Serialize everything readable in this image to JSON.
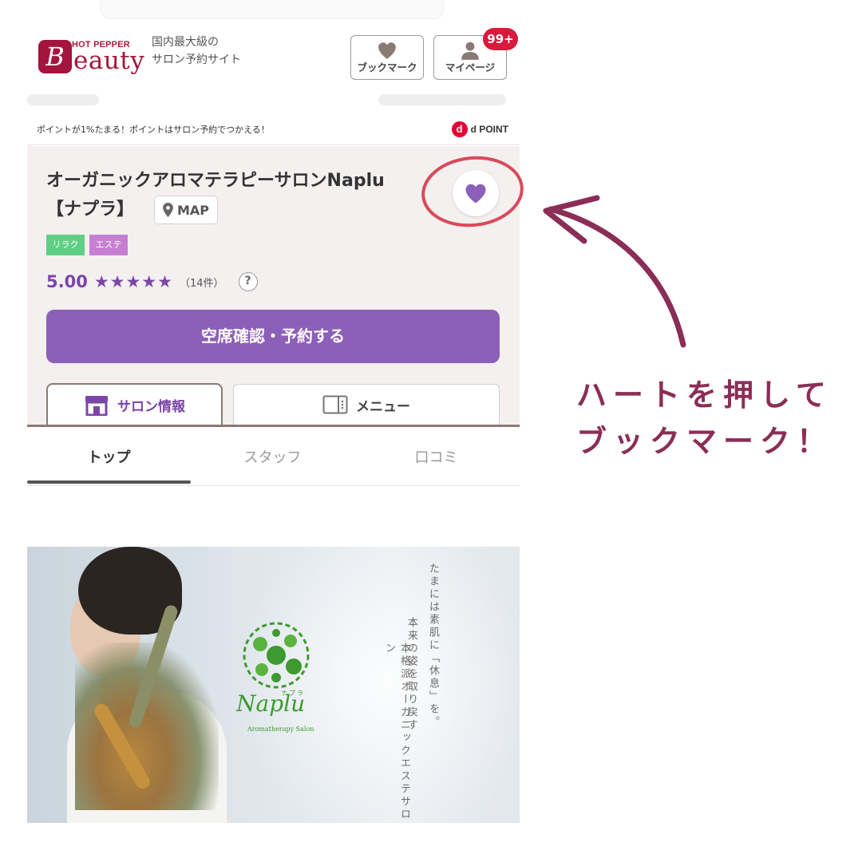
{
  "header": {
    "logo_brand_small": "HOT PEPPER",
    "logo_brand_initial": "B",
    "logo_brand_word": "eauty",
    "tagline": "国内最大級の\nサロン予約サイト",
    "bookmark_label": "ブックマーク",
    "mypage_label": "マイページ",
    "notification_count": "99+"
  },
  "points_bar": {
    "text": "ポイントが1%たまる！ポイントはサロン予約でつかえる！",
    "d_icon": "d",
    "d_point_label": "POINT"
  },
  "salon": {
    "name_line1": "オーガニックアロマテラピーサロンNaplu",
    "name_line2": "【ナプラ】",
    "map_label": "MAP",
    "tags": [
      "リラク",
      "エステ"
    ],
    "rating": "5.00",
    "stars": "★★★★★",
    "review_count": "（14件）",
    "help_icon": "?",
    "reserve_label": "空席確認・予約する"
  },
  "tabs": {
    "salon_info": "サロン情報",
    "menu": "メニュー"
  },
  "subtabs": [
    "トップ",
    "スタッフ",
    "口コミ"
  ],
  "hero": {
    "brand_name": "Naplu",
    "brand_ruby": "ナプラ",
    "brand_sub": "Aromatherapy Salon",
    "copy_line1": "たまには素肌に「休息」を。",
    "copy_line2": "本来の姿を取り戻す",
    "copy_line3": "本格派オーガニックエステサロン"
  },
  "annotation": {
    "line1": "ハートを押して",
    "line2": "ブックマーク！"
  },
  "colors": {
    "brand": "#a4143c",
    "accent_purple": "#8c5fb9",
    "annotation": "#8a2e57",
    "badge": "#d81b3c"
  }
}
